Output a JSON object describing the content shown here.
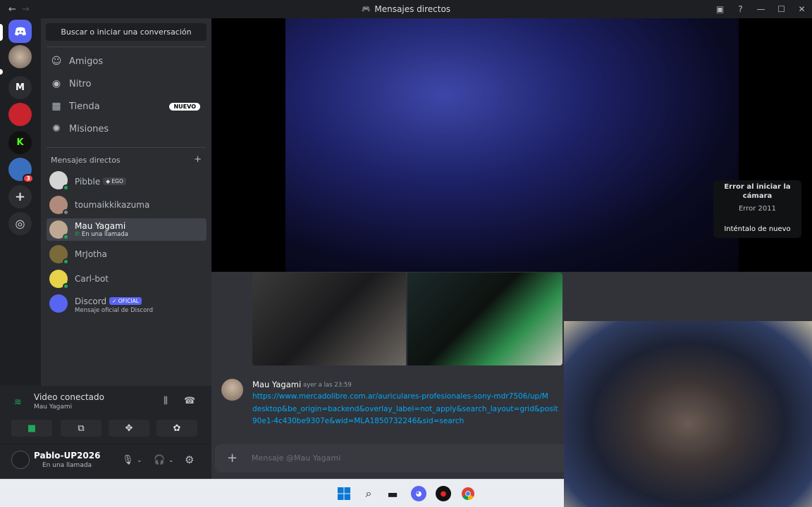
{
  "window": {
    "title": "Mensajes directos",
    "back": "←",
    "forward": "→",
    "controls": [
      "▣",
      "?",
      "—",
      "☐",
      "✕"
    ]
  },
  "guilds": {
    "home_letter": "M",
    "badge": "3",
    "add": "+",
    "explore": "◎"
  },
  "sidebar": {
    "search_label": "Buscar o iniciar una conversación",
    "nav": [
      {
        "label": "Amigos",
        "icon": "friends-icon"
      },
      {
        "label": "Nitro",
        "icon": "nitro-icon"
      },
      {
        "label": "Tienda",
        "icon": "shop-icon",
        "badge": "NUEVO"
      },
      {
        "label": "Misiones",
        "icon": "quests-icon"
      }
    ],
    "dm_header": "Mensajes directos",
    "dm_add": "+",
    "dms": [
      {
        "name": "Pibble",
        "tag": "EGO",
        "color": "#d4d4d4",
        "status": "#23a55a"
      },
      {
        "name": "toumaikkikazuma",
        "tag": "",
        "color": "#b08a7a",
        "status": "#80848e"
      },
      {
        "name": "Mau Yagami",
        "sub": "En una llamada",
        "color": "#bda892",
        "status": "#23a55a"
      },
      {
        "name": "MrJotha",
        "color": "#7a6a3a",
        "status": "#23a55a"
      },
      {
        "name": "Carl-bot",
        "color": "#e6d34a",
        "status": "#23a55a"
      },
      {
        "name": "Discord",
        "tag": "OFICIAL",
        "sub": "Mensaje oficial de Discord",
        "color": "#5865f2",
        "status": ""
      }
    ]
  },
  "voice": {
    "status": "Video conectado",
    "channel": "Mau Yagami"
  },
  "user_panel": {
    "name": "Pablo-UP2026",
    "status": "En una llamada"
  },
  "call": {
    "error_title": "Error al iniciar la cámara",
    "error_code": "Error 2011",
    "retry": "Inténtalo de nuevo"
  },
  "message": {
    "author": "Mau Yagami",
    "time": "ayer a las 23:59",
    "link_lines": [
      "https://www.mercadolibre.com.ar/auriculares-profesionales-sony-mdr7506/up/M",
      "desktop&be_origin=backend&overlay_label=not_apply&search_layout=grid&posit",
      "90e1-4c430be9307e&wid=MLA1850732246&sid=search"
    ]
  },
  "composer": {
    "placeholder": "Mensaje @Mau Yagami",
    "plus": "+"
  },
  "colors": {
    "accent": "#5865f2",
    "link": "#00a8fc",
    "online": "#23a55a",
    "bg": "#313338"
  }
}
